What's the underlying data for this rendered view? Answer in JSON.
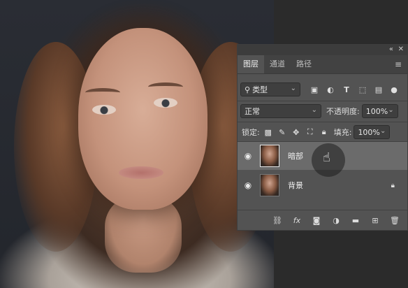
{
  "panel": {
    "tabs": [
      {
        "label": "图层",
        "active": true
      },
      {
        "label": "通道",
        "active": false
      },
      {
        "label": "路径",
        "active": false
      }
    ],
    "filter": {
      "value": "类型"
    },
    "blend_mode": {
      "value": "正常"
    },
    "opacity": {
      "label": "不透明度:",
      "value": "100%"
    },
    "lock_label": "锁定:",
    "fill": {
      "label": "填充:",
      "value": "100%"
    },
    "layers": [
      {
        "name": "暗部",
        "visible": true,
        "selected": true,
        "locked": false
      },
      {
        "name": "背景",
        "visible": true,
        "selected": false,
        "locked": true
      }
    ]
  },
  "colors": {
    "panel_bg": "#535353",
    "selected_row": "#6b6b6b",
    "tab_bar": "#424242"
  }
}
